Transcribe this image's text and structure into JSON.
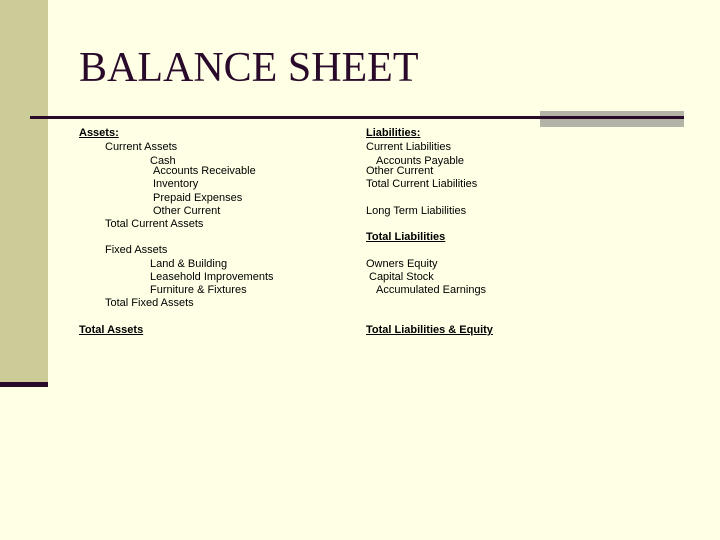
{
  "title": "BALANCE SHEET",
  "assets": {
    "header": "Assets:",
    "current_assets": "Current Assets",
    "cash": "Cash",
    "accounts_receivable": "Accounts Receivable",
    "inventory": "Inventory",
    "prepaid_expenses": "Prepaid Expenses",
    "other_current": "Other Current",
    "total_current_assets": "Total Current Assets",
    "fixed_assets": "Fixed Assets",
    "land_building": "Land & Building",
    "leasehold_improvements": "Leasehold Improvements",
    "furniture_fixtures": "Furniture & Fixtures",
    "total_fixed_assets": "Total Fixed Assets",
    "total_assets": "Total Assets "
  },
  "liabilities": {
    "header": "Liabilities:",
    "current_liabilities": "Current Liabilities",
    "accounts_payable": "Accounts Payable",
    "other_current": "Other Current",
    "total_current_liabilities": "Total Current Liabilities",
    "long_term_liabilities": "Long Term Liabilities",
    "total_liabilities": "Total Liabilities",
    "owners_equity": "Owners Equity",
    "capital_stock": "Capital Stock",
    "accumulated_earnings": "Accumulated Earnings",
    "total_liabilities_equity": "Total Liabilities & Equity"
  },
  "colors": {
    "background": "#ffffe5",
    "sidebar": "#cccc99",
    "accent_dark": "#2a0a2a",
    "accent_gray": "#b3b3a8"
  }
}
